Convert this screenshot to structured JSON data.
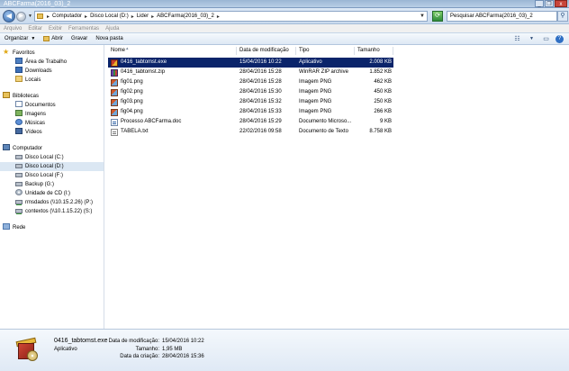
{
  "window": {
    "title": "ABCFarma(2016_03)_2",
    "buttons": {
      "minimize": "_",
      "maximize": "❐",
      "close": "x"
    }
  },
  "address": {
    "crumbs": [
      "Computador",
      "Disco Local (D:)",
      "Lider",
      "ABCFarma(2016_03)_2"
    ],
    "search_placeholder": "Pesquisar ABCFarma(2016_03)_2"
  },
  "menu": [
    "Arquivo",
    "Editar",
    "Exibir",
    "Ferramentas",
    "Ajuda"
  ],
  "commands": {
    "organize": "Organizar",
    "open": "Abrir",
    "burn": "Gravar",
    "new_folder": "Nova pasta"
  },
  "sidebar": {
    "favorites": {
      "label": "Favoritos",
      "items": [
        "Área de Trabalho",
        "Downloads",
        "Locais"
      ]
    },
    "libraries": {
      "label": "Bibliotecas",
      "items": [
        "Documentos",
        "Imagens",
        "Músicas",
        "Vídeos"
      ]
    },
    "computer": {
      "label": "Computador",
      "items": [
        "Disco Local (C:)",
        "Disco Local (D:)",
        "Disco Local (F:)",
        "Backup (G:)",
        "Unidade de CD (I:)",
        "rmsdados (\\\\10.15.2.26) (P:)",
        "contextos (\\\\10.1.15.22) (S:)"
      ]
    },
    "network": {
      "label": "Rede"
    }
  },
  "columns": {
    "name": "Nome",
    "date": "Data de modificação",
    "type": "Tipo",
    "size": "Tamanho"
  },
  "files": [
    {
      "name": "0416_tabtomst.exe",
      "date": "15/04/2016 10:22",
      "type": "Aplicativo",
      "size": "2.008 KB"
    },
    {
      "name": "0416_tabtomst.zip",
      "date": "28/04/2016 15:28",
      "type": "WinRAR ZIP archive",
      "size": "1.852 KB"
    },
    {
      "name": "fig01.png",
      "date": "28/04/2016 15:28",
      "type": "Imagem PNG",
      "size": "462 KB"
    },
    {
      "name": "fig02.png",
      "date": "28/04/2016 15:30",
      "type": "Imagem PNG",
      "size": "450 KB"
    },
    {
      "name": "fig03.png",
      "date": "28/04/2016 15:32",
      "type": "Imagem PNG",
      "size": "250 KB"
    },
    {
      "name": "fig04.png",
      "date": "28/04/2016 15:33",
      "type": "Imagem PNG",
      "size": "266 KB"
    },
    {
      "name": "Processo ABCFarma.doc",
      "date": "28/04/2016 15:29",
      "type": "Documento Microso...",
      "size": "9 KB"
    },
    {
      "name": "TABELA.txt",
      "date": "22/02/2016 09:58",
      "type": "Documento de Texto",
      "size": "8.758 KB"
    }
  ],
  "details": {
    "name": "0416_tabtomst.exe",
    "type": "Aplicativo",
    "modified_label": "Data de modificação:",
    "modified": "15/04/2016 10:22",
    "size_label": "Tamanho:",
    "size": "1,95 MB",
    "created_label": "Data da criação:",
    "created": "28/04/2016 15:36"
  }
}
